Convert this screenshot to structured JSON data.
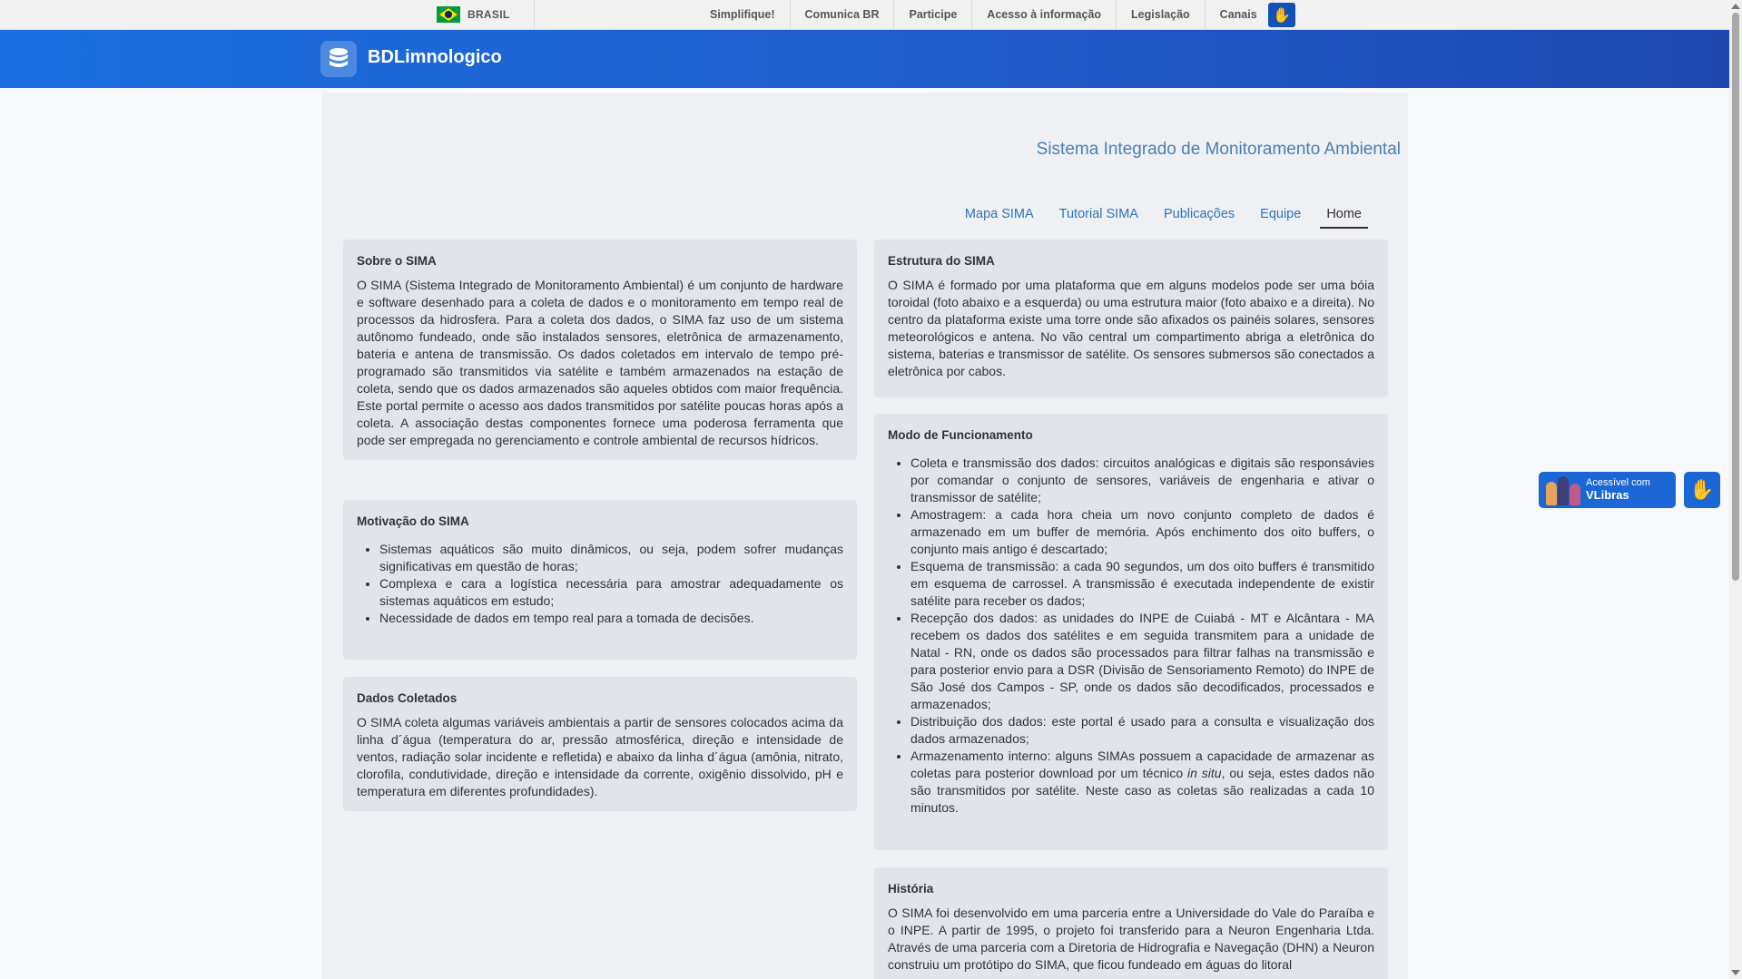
{
  "gov_bar": {
    "brasil_label": "BRASIL",
    "links": [
      "Simplifique!",
      "Comunica BR",
      "Participe",
      "Acesso à informação",
      "Legislação",
      "Canais"
    ]
  },
  "header": {
    "title": "BDLimnologico",
    "logo_icon": "database-icon"
  },
  "page": {
    "subtitle": "Sistema Integrado de Monitoramento Ambiental",
    "nav": [
      "Mapa SIMA",
      "Tutorial SIMA",
      "Publicações",
      "Equipe",
      "Home"
    ],
    "active_nav": "Home"
  },
  "cards": {
    "sobre": {
      "title": "Sobre o SIMA",
      "text": "O SIMA (Sistema Integrado de Monitoramento Ambiental) é um conjunto de hardware e software desenhado para a coleta de dados e o monitoramento em tempo real de processos da hidrosfera. Para a coleta dos dados, o SIMA faz uso de um sistema autônomo fundeado, onde são instalados sensores, eletrônica de armazenamento, bateria e antena de transmissão. Os dados coletados em intervalo de tempo pré-programado são transmitidos via satélite e também armazenados na estação de coleta, sendo que os dados armazenados são aqueles obtidos com maior frequência. Este portal permite o acesso aos dados transmitidos por satélite poucas horas após a coleta. A associação destas componentes fornece uma poderosa ferramenta que pode ser empregada no gerenciamento e controle ambiental de recursos hídricos."
    },
    "motivacao": {
      "title": "Motivação do SIMA",
      "items": [
        "Sistemas aquáticos são muito dinâmicos, ou seja, podem sofrer mudanças significativas em questão de horas;",
        "Complexa e cara a logística necessária para amostrar adequadamente os sistemas aquáticos em estudo;",
        "Necessidade de dados em tempo real para a tomada de decisões."
      ]
    },
    "dados": {
      "title": "Dados Coletados",
      "text": "O SIMA coleta algumas variáveis ambientais a partir de sensores colocados acima da linha d´água (temperatura do ar, pressão atmosférica, direção e intensidade de ventos, radiação solar incidente e refletida) e abaixo da linha d´água (amônia, nitrato, clorofila, condutividade, direção e intensidade da corrente, oxigênio dissolvido, pH e temperatura em diferentes profundidades)."
    },
    "estrutura": {
      "title": "Estrutura do SIMA",
      "text": "O SIMA é formado por uma plataforma que em alguns modelos pode ser uma bóia toroidal (foto abaixo e a esquerda) ou uma estrutura maior (foto abaixo e a direita). No centro da plataforma existe uma torre onde são afixados os painéis solares, sensores meteorológicos e antena. No vão central um compartimento abriga a eletrônica do sistema, baterias e transmissor de satélite. Os sensores submersos são conectados a eletrônica por cabos."
    },
    "modo": {
      "title": "Modo de Funcionamento",
      "items": [
        "Coleta e transmissão dos dados: circuitos analógicas e digitais são responsávies por comandar o conjunto de sensores, variáveis de engenharia e ativar o transmissor de satélite;",
        "Amostragem: a cada hora cheia um novo conjunto completo de dados é armazenado em um buffer de memória. Após enchimento dos oito buffers, o conjunto mais antigo é descartado;",
        "Esquema de transmissão: a cada 90 segundos, um dos oito buffers é transmitido em esquema de carrossel. A transmissão é executada independente de existir satélite para receber os dados;",
        "Recepção dos dados: as unidades do INPE de Cuiabá - MT e Alcântara - MA recebem os dados dos satélites e em seguida transmitem para a unidade de Natal - RN, onde os dados são processados para filtrar falhas na transmissão e para posterior envio para a DSR (Divisão de Sensoriamento Remoto) do INPE de São José dos Campos - SP, onde os dados são decodificados, processados e armazenados;",
        "Distribuição dos dados: este portal é usado para a consulta e visualização dos dados armazenados;"
      ],
      "last_item_before": "Armazenamento interno: alguns SIMAs possuem a capacidade de armazenar as coletas para posterior download por um técnico ",
      "last_item_italic": "in situ",
      "last_item_after": ", ou seja, estes dados não são transmitidos por satélite. Neste caso as coletas são realizadas a cada 10 minutos."
    },
    "historia": {
      "title": "História",
      "text": "O SIMA foi desenvolvido em uma parceria entre a Universidade do Vale do Paraíba e o INPE. A partir de 1995, o projeto foi transferido para a Neuron Engenharia Ltda. Através de uma parceria com a Diretoria de Hidrografia e Navegação (DHN) a Neuron construiu um protótipo do SIMA, que ficou fundeado em águas do litoral"
    }
  },
  "vlibras": {
    "line1": "Acessível com",
    "line2": "VLibras"
  },
  "colors": {
    "header_blue": "#1f5ac8",
    "link_blue": "#2a74b8",
    "card_bg": "#e2e4ec"
  }
}
